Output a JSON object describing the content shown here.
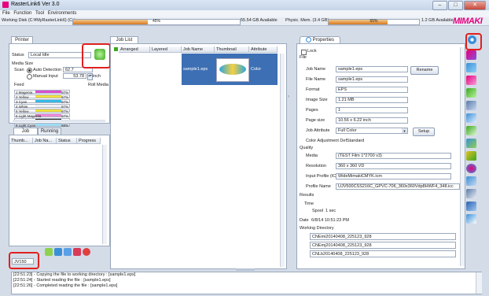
{
  "window": {
    "title": "RasterLink6 Ver 3.0"
  },
  "menu": [
    "File",
    "Function",
    "Tool",
    "Environments"
  ],
  "status": {
    "disk_label": "Working Disk (C:¥MyRasterLink6) (C:)",
    "disk_progress": 45,
    "disk_pct": "45%",
    "disk_avail": "55.54 GB Available",
    "mem_label": "Physic. Mem. (3.4 GB)",
    "mem_progress": 65,
    "mem_pct": "65%",
    "mem_avail": "1.2 GB Available"
  },
  "brand": {
    "logo": "MIMAKI",
    "color": "#e6007e"
  },
  "printer": {
    "tab": "Printer",
    "status_label": "Status",
    "status_value": "Local Idle",
    "media_size": "Media Size",
    "scan_label": "Scan",
    "auto_detection": "Auto Detection",
    "scan_value": "62.7",
    "manual_input": "Manual Input",
    "manual_value": "53.78",
    "unit": "inch",
    "feed_label": "Feed",
    "feed_value": "Roll Media",
    "inks": [
      {
        "name": "1 Magenta",
        "pct": "97%",
        "level": 97,
        "color": "#d94fd1"
      },
      {
        "name": "2 Yellow",
        "pct": "97%",
        "level": 97,
        "color": "#f0e040"
      },
      {
        "name": "3 Cyan",
        "pct": "97%",
        "level": 97,
        "color": "#36b9e8"
      },
      {
        "name": "4 White",
        "pct": "97%",
        "level": 97,
        "color": "#eef0f4"
      },
      {
        "name": "5 Yellow",
        "pct": "97%",
        "level": 97,
        "color": "#f0e040"
      },
      {
        "name": "6 Light Magenta",
        "pct": "97%",
        "level": 97,
        "color": "#f08ad8"
      },
      {
        "name": "7 Black",
        "pct": "97%",
        "level": 97,
        "color": "#202020"
      },
      {
        "name": "8 Light Cyan",
        "pct": "98%",
        "level": 98,
        "color": "#9fdcf2"
      }
    ]
  },
  "queue": {
    "tabs": [
      "Job Queue",
      "Running"
    ],
    "columns": [
      "Thumb...",
      "Job Na...",
      "Status",
      "Progress"
    ]
  },
  "joblist": {
    "tab": "Job List",
    "columns": [
      "Arranged",
      "Layered",
      "Job Name",
      "Thumbnail",
      "Attribute"
    ],
    "rows": [
      {
        "job_name": "sample1.eps",
        "attribute": "Color"
      }
    ]
  },
  "device_tab": "JV150",
  "properties": {
    "tab": "Properties",
    "lock": "Lock",
    "file_section": "File",
    "rows_file": [
      {
        "k": "Job Name",
        "v": "sample1.eps"
      },
      {
        "k": "File Name",
        "v": "sample1.eps"
      },
      {
        "k": "Format",
        "v": "EPS"
      },
      {
        "k": "Image Size",
        "v": "1.21 MB"
      },
      {
        "k": "Pages",
        "v": "1"
      },
      {
        "k": "Page size",
        "v": "10.56 x 6.22 inch"
      },
      {
        "k": "Job Attribute",
        "v": "Full Color"
      },
      {
        "k": "Color Adjustment Def.",
        "v": "Standard"
      }
    ],
    "rename": "Rename",
    "setup": "Setup",
    "quality_section": "Quality",
    "rows_quality": [
      {
        "k": "Media",
        "v": "(TEST Film 1*2700 v3)"
      },
      {
        "k": "Resolution",
        "v": "360 x 360 VD"
      },
      {
        "k": "Input Profile (ICC)",
        "v": "WideMimakiCMYK.icm"
      },
      {
        "k": "Profile Name",
        "v": "UJV500CSS216C_GPVC-706_360x360Vdp8HWF4_348.icc"
      }
    ],
    "results_section": "Results",
    "time_label": "Time",
    "spool_label": "Spool",
    "spool_value": "1 sec",
    "date_label": "Date",
    "date_value": "6/8/14 10:51:23 PM",
    "workdir_label": "Working Directory",
    "workdirs": [
      "CNEmi20140408_225123_928",
      "CNEmj20140408_225123_928",
      "CNLb20140408_225123_928"
    ]
  },
  "log": [
    "[22:51:23] - Copying the file to working directory : [sample1.eps]",
    "[22:51:24] - Started reading the file : [sample1.eps]",
    "[22:51:26] - Completed reading the file : [sample1.eps]"
  ]
}
